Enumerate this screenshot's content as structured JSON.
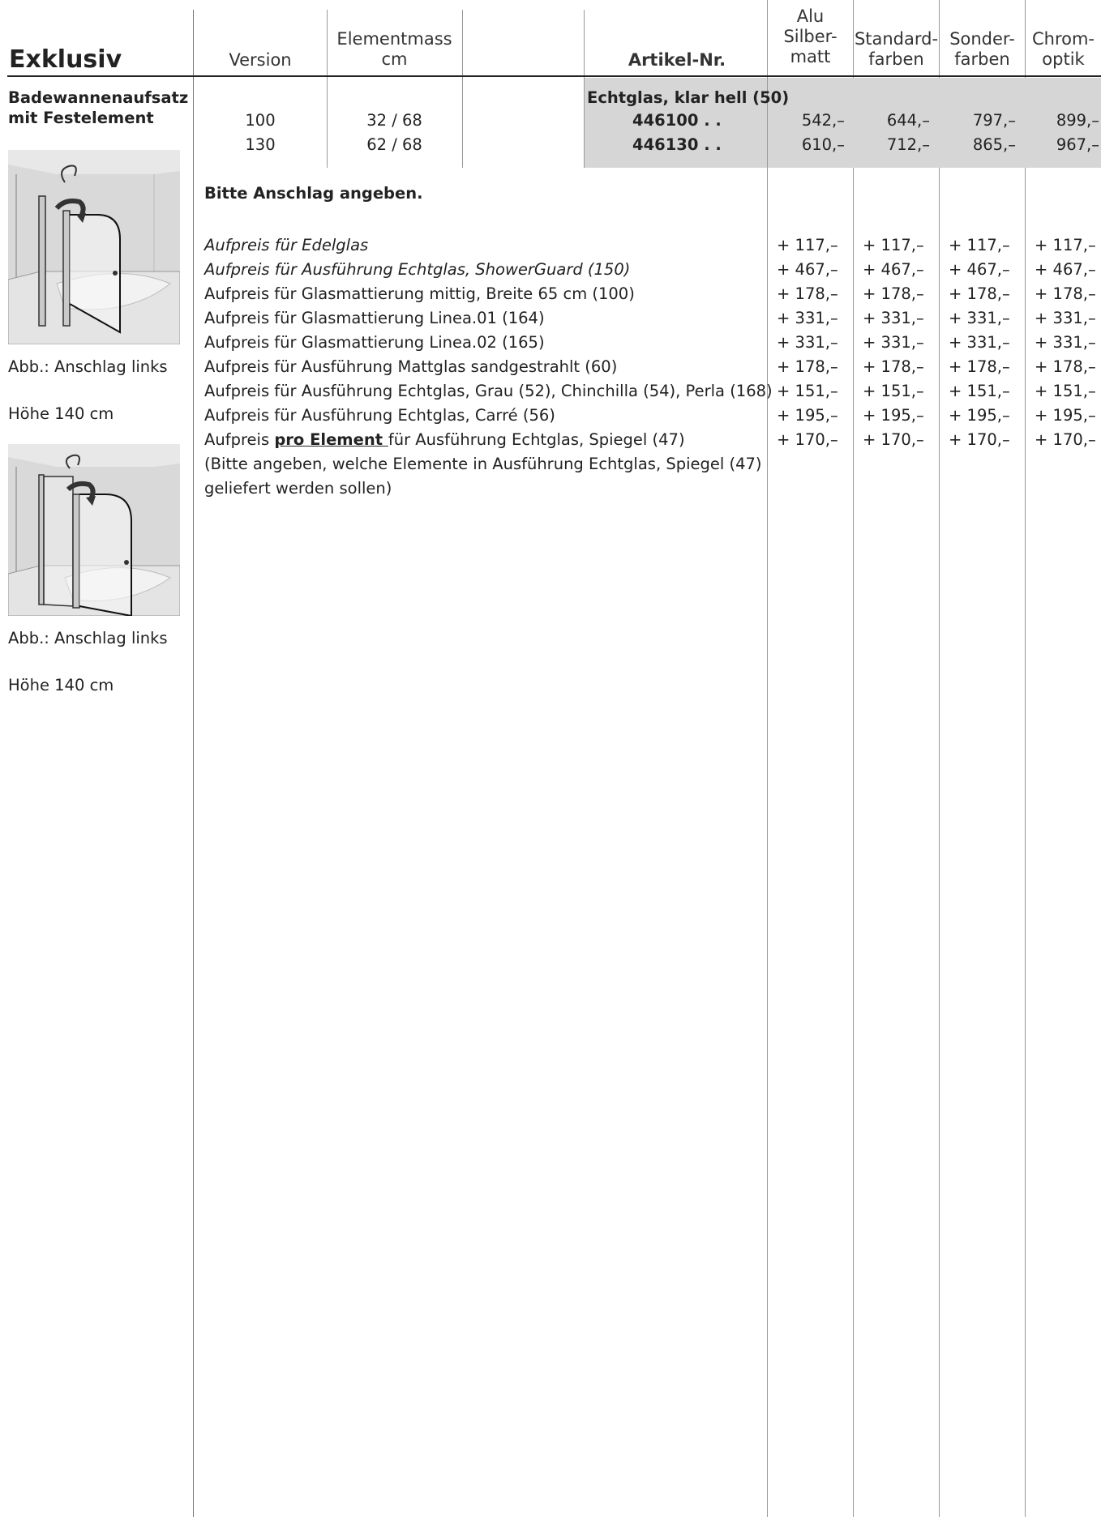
{
  "header": {
    "title": "Exklusiv",
    "col_version": "Version",
    "col_elementmass_1": "Elementmass",
    "col_elementmass_2": "cm",
    "col_artikel": "Artikel-Nr.",
    "col_alu_1": "Alu",
    "col_alu_2": "Silber-",
    "col_alu_3": "matt",
    "col_std_1": "Standard-",
    "col_std_2": "farben",
    "col_sonder_1": "Sonder-",
    "col_sonder_2": "farben",
    "col_chrom_1": "Chrom-",
    "col_chrom_2": "optik"
  },
  "product": {
    "name_1": "Badewannenaufsatz",
    "name_2": "mit Festelement",
    "glass_label": "Echtglas, klar hell (50)",
    "rows": [
      {
        "version": "100",
        "mass": "32 / 68",
        "artikel": "446100 . .",
        "alu": "542,–",
        "std": "644,–",
        "sonder": "797,–",
        "chrom": "899,–"
      },
      {
        "version": "130",
        "mass": "62 / 68",
        "artikel": "446130 . .",
        "alu": "610,–",
        "std": "712,–",
        "sonder": "865,–",
        "chrom": "967,–"
      }
    ]
  },
  "notes": {
    "anschlag": "Bitte Anschlag angeben.",
    "surcharges": [
      {
        "label": "Aufpreis für Edelglas",
        "italic": true,
        "alu": "+ 117,–",
        "std": "+ 117,–",
        "sonder": "+ 117,–",
        "chrom": "+ 117,–"
      },
      {
        "label": "Aufpreis für Ausführung Echtglas, ShowerGuard (150)",
        "italic": true,
        "alu": "+ 467,–",
        "std": "+ 467,–",
        "sonder": "+ 467,–",
        "chrom": "+ 467,–"
      },
      {
        "label": "Aufpreis für Glasmattierung mittig, Breite 65 cm (100)",
        "italic": false,
        "alu": "+ 178,–",
        "std": "+ 178,–",
        "sonder": "+ 178,–",
        "chrom": "+ 178,–"
      },
      {
        "label": "Aufpreis für Glasmattierung Linea.01 (164)",
        "italic": false,
        "alu": "+ 331,–",
        "std": "+ 331,–",
        "sonder": "+ 331,–",
        "chrom": "+ 331,–"
      },
      {
        "label": "Aufpreis für Glasmattierung Linea.02 (165)",
        "italic": false,
        "alu": "+ 331,–",
        "std": "+ 331,–",
        "sonder": "+ 331,–",
        "chrom": "+ 331,–"
      },
      {
        "label": "Aufpreis für Ausführung Mattglas sandgestrahlt (60)",
        "italic": false,
        "alu": "+ 178,–",
        "std": "+ 178,–",
        "sonder": "+ 178,–",
        "chrom": "+ 178,–"
      },
      {
        "label": "Aufpreis für Ausführung Echtglas, Grau (52), Chinchilla (54), Perla (168)",
        "italic": false,
        "alu": "+ 151,–",
        "std": "+ 151,–",
        "sonder": "+ 151,–",
        "chrom": "+ 151,–"
      },
      {
        "label": "Aufpreis für Ausführung Echtglas, Carré (56)",
        "italic": false,
        "alu": "+ 195,–",
        "std": "+ 195,–",
        "sonder": "+ 195,–",
        "chrom": "+ 195,–"
      }
    ],
    "spiegel_prefix": "Aufpreis ",
    "spiegel_bold": "pro Element ",
    "spiegel_suffix": "für Ausführung Echtglas, Spiegel (47)",
    "spiegel_prices": {
      "alu": "+ 170,–",
      "std": "+ 170,–",
      "sonder": "+ 170,–",
      "chrom": "+ 170,–"
    },
    "spiegel_note_1": "(Bitte angeben, welche Elemente in Ausführung Echtglas, Spiegel (47)",
    "spiegel_note_2": "geliefert werden sollen)"
  },
  "images": [
    {
      "caption": "Abb.: Anschlag links",
      "height": "Höhe 140 cm",
      "icon": "shower-screen-illustration"
    },
    {
      "caption": "Abb.: Anschlag links",
      "height": "Höhe 140 cm",
      "icon": "shower-screen-illustration"
    }
  ],
  "colors": {
    "shade": "#d6d6d6",
    "rule": "#222222",
    "divider": "#999999"
  }
}
